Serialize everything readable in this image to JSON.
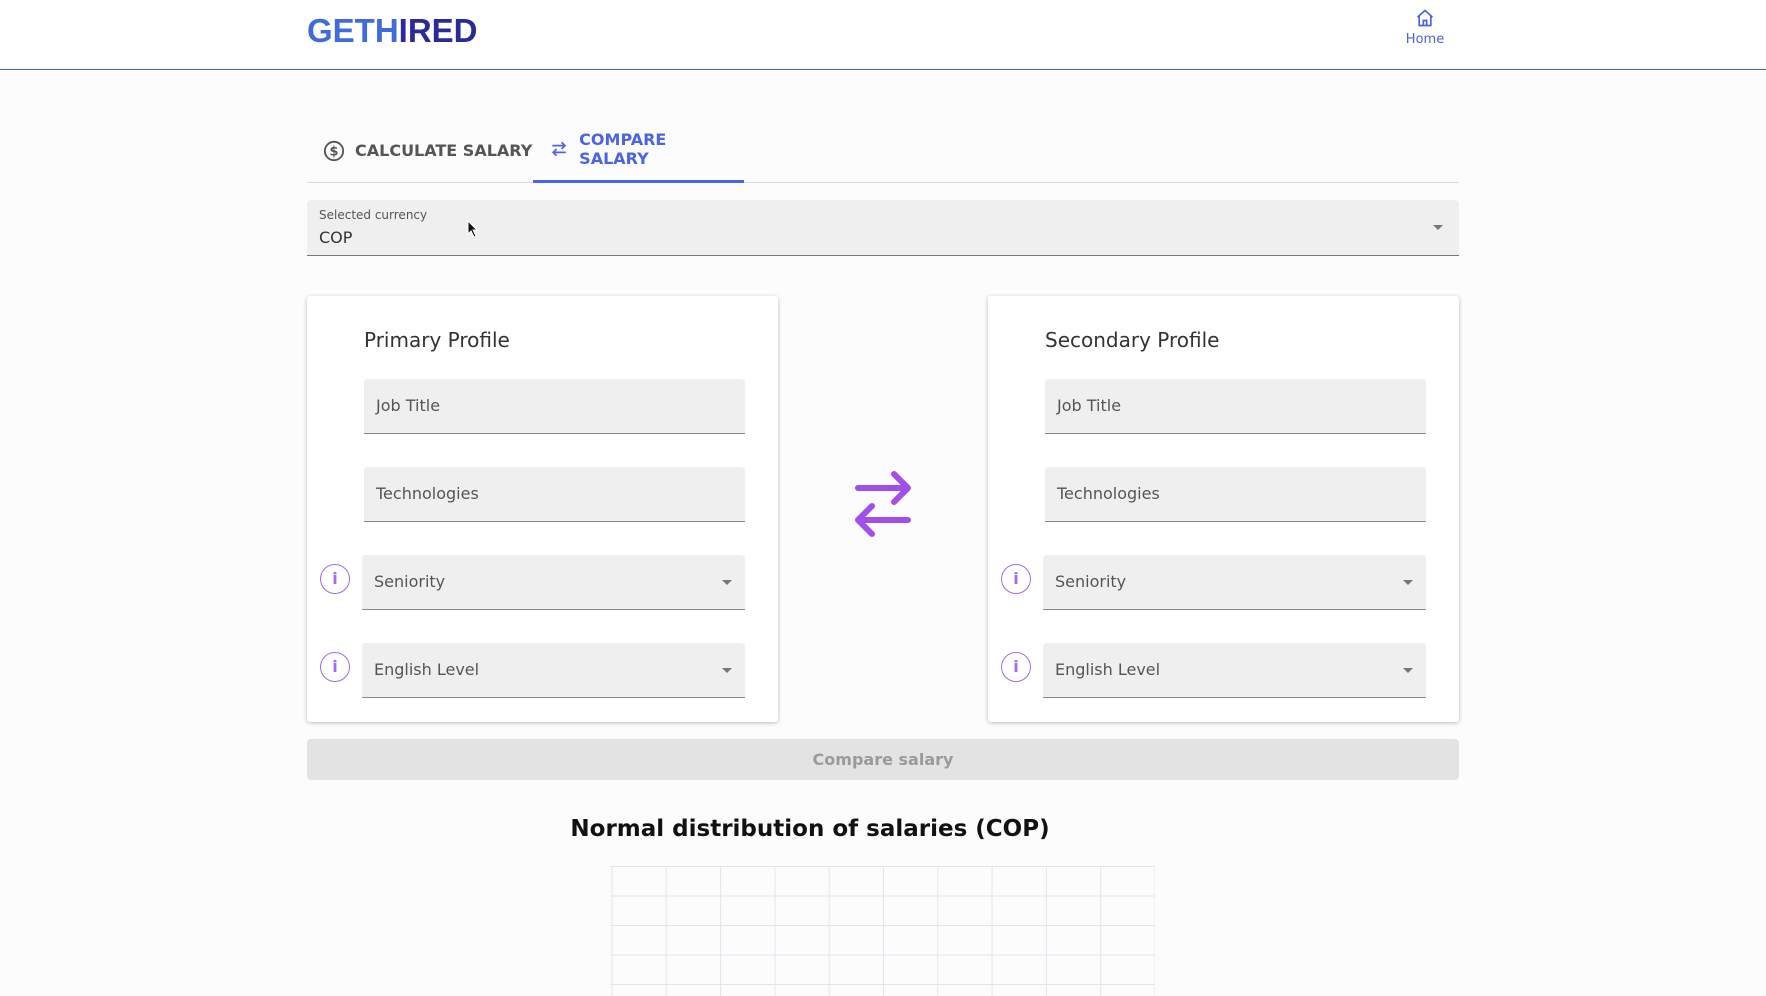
{
  "header": {
    "logo": "GETHIRED",
    "home_label": "Home"
  },
  "tabs": [
    {
      "label": "CALCULATE SALARY",
      "icon": "dollar-circle-icon",
      "active": false
    },
    {
      "label": "COMPARE SALARY",
      "icon": "swap-arrows-icon",
      "active": true
    }
  ],
  "currency": {
    "label": "Selected currency",
    "value": "COP"
  },
  "primary": {
    "title": "Primary Profile",
    "job_title": "Job Title",
    "technologies": "Technologies",
    "seniority": "Seniority",
    "english": "English Level"
  },
  "secondary": {
    "title": "Secondary Profile",
    "job_title": "Job Title",
    "technologies": "Technologies",
    "seniority": "Seniority",
    "english": "English Level"
  },
  "compare_button": "Compare salary",
  "chart": {
    "title": "Normal distribution of salaries (COP)"
  },
  "colors": {
    "accent": "#4b63e6",
    "purple": "#a26be8",
    "logo": "#2b2a9a"
  }
}
